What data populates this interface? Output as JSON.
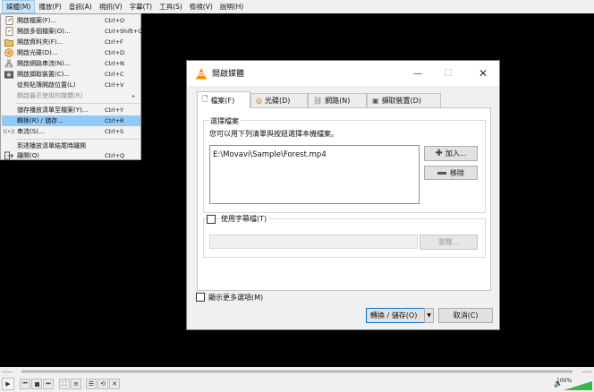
{
  "menubar": {
    "items": [
      "媒體(M)",
      "播放(P)",
      "音訊(A)",
      "視訊(V)",
      "字幕(T)",
      "工具(S)",
      "檢視(V)",
      "說明(H)"
    ]
  },
  "media_menu": {
    "items": [
      {
        "label": "開啟檔案(F)...",
        "shortcut": "Ctrl+O",
        "icon": "open-file-icon"
      },
      {
        "label": "開啟多個檔案(O)...",
        "shortcut": "Ctrl+Shift+O",
        "icon": "open-multiple-files-icon"
      },
      {
        "label": "開啟資料夾(F)...",
        "shortcut": "Ctrl+F",
        "icon": "folder-icon"
      },
      {
        "label": "開啟光碟(D)...",
        "shortcut": "Ctrl+D",
        "icon": "disc-icon"
      },
      {
        "label": "開啟網路串流(N)...",
        "shortcut": "Ctrl+N",
        "icon": "network-icon"
      },
      {
        "label": "開啟擷取裝置(C)...",
        "shortcut": "Ctrl+C",
        "icon": "capture-device-icon"
      },
      {
        "label": "從剪貼簿開啟位置(L)",
        "shortcut": "Ctrl+V",
        "icon": ""
      },
      {
        "label": "開啟最近使用的媒體(R)",
        "shortcut": "",
        "icon": ""
      },
      {
        "label": "儲存播放清單至檔案(Y)...",
        "shortcut": "Ctrl+Y",
        "icon": ""
      },
      {
        "label": "轉換(R) / 儲存...",
        "shortcut": "Ctrl+R",
        "icon": ""
      },
      {
        "label": "串流(S)...",
        "shortcut": "Ctrl+S",
        "icon": "stream-icon"
      },
      {
        "label": "到達播放清單結尾時離開",
        "shortcut": "",
        "icon": ""
      },
      {
        "label": "離開(Q)",
        "shortcut": "Ctrl+Q",
        "icon": "quit-icon"
      }
    ]
  },
  "dialog": {
    "title": "開啟媒體",
    "tabs": [
      "檔案(F)",
      "光碟(D)",
      "網路(N)",
      "擷取裝置(D)"
    ],
    "file_group_title": "選擇檔案",
    "file_desc": "您可以用下列清單與按鈕選擇本機檔案。",
    "files": [
      "E:\\Movavi\\Sample\\Forest.mp4"
    ],
    "add_button": "加入...",
    "remove_button": "移除",
    "subtitle_checkbox": "使用字幕檔(T)",
    "browse_button": "瀏覽...",
    "more_options": "顯示更多選項(M)",
    "convert_button": "轉換 / 儲存(O)",
    "cancel_button": "取消(C)"
  },
  "player": {
    "time_left": "--:--",
    "time_right": "--:--",
    "volume": "100%",
    "volume_level": 1.0
  }
}
